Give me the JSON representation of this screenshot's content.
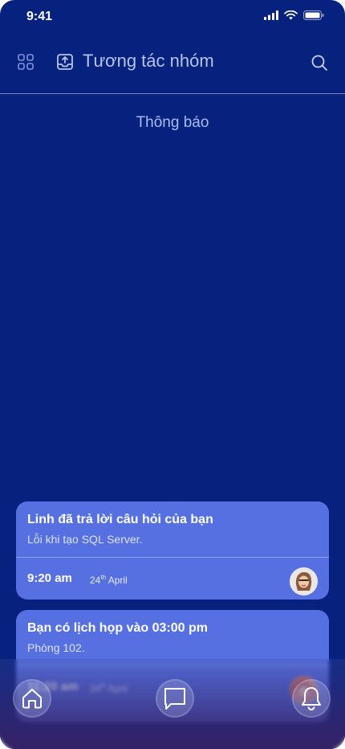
{
  "status_bar": {
    "time": "9:41"
  },
  "header": {
    "title": "Tương tác nhóm"
  },
  "section": {
    "title": "Thông báo"
  },
  "notifications": [
    {
      "title": "Linh đã trả lời câu hỏi của bạn",
      "subtitle": "Lỗi khi tạo SQL Server.",
      "time": "9:20 am",
      "day": "24",
      "day_suffix": "th",
      "month": "April"
    },
    {
      "title": "Bạn có lịch họp vào 03:00 pm",
      "subtitle": "Phòng 102.",
      "time": "11:20 am",
      "day": "24",
      "day_suffix": "th",
      "month": "April"
    }
  ],
  "colors": {
    "background": "#07227e",
    "card": "#5670e2",
    "accent_text": "#a9bbf0"
  },
  "icons": [
    "grid-icon",
    "inbox-upload-icon",
    "search-icon",
    "home-icon",
    "chat-icon",
    "bell-icon",
    "signal-icon",
    "wifi-icon",
    "battery-icon"
  ]
}
